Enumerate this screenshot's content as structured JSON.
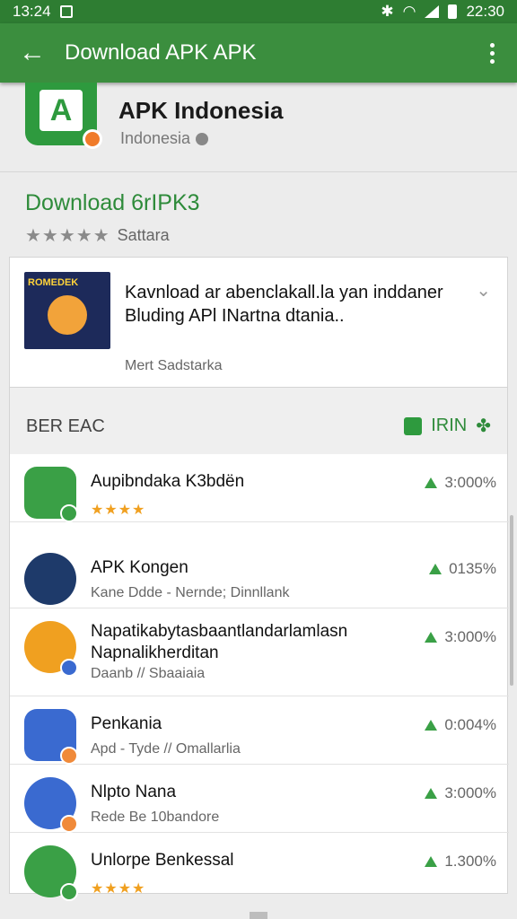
{
  "status_bar": {
    "time": "13:24",
    "clock_right": "22:30",
    "icons": [
      "notification-icon",
      "bluetooth-icon",
      "wifi-icon",
      "signal-icon",
      "battery-icon"
    ]
  },
  "app_bar": {
    "title": "Download APK APK",
    "back_icon": "arrow-back-icon",
    "menu_icon": "more-vert-icon"
  },
  "app": {
    "name": "APK Indonesia",
    "subtitle": "Indonesia",
    "icon_letter": "A"
  },
  "download": {
    "title": "Download 6rIPK3",
    "rating_label": "Sattara",
    "stars": "★★★★★"
  },
  "feature": {
    "thumb_brand": "ROMEDEK",
    "text": "Kavnload ar abenclakall.la yan inddaner Bluding APl INartna dtania..",
    "meta": "Mert Sadstarka"
  },
  "section": {
    "label": "BER EAC",
    "right_label": "IRIN"
  },
  "colors": {
    "app_bar": "#3b8e3e",
    "status_bar": "#2e7d32",
    "accent_green": "#2e8b3a",
    "star_gold": "#f0a020"
  },
  "list": [
    {
      "name": "Aupibndaka K3bdën",
      "desc": "",
      "stars": "★★★★",
      "pct": "3:000%",
      "icon_color": "#3aa046",
      "badge_color": "#3aa046"
    },
    {
      "name": "APK Kongen",
      "desc": "Kane Ddde - Nernde; Dinnllank",
      "stars": "",
      "pct": "0135%",
      "icon_color": "#1e3a6a",
      "badge_color": ""
    },
    {
      "name": "Napatikabytasbaantlandarlamlasn Napnalikherditan",
      "desc": "Daanb // Sbaaiaia",
      "stars": "",
      "pct": "3:000%",
      "icon_color": "#f0a020",
      "badge_color": "#3a6ad0"
    },
    {
      "name": "Penkania",
      "desc": "Aрd - Tyde // Omallarlia",
      "stars": "",
      "pct": "0:004%",
      "icon_color": "#3a6ad0",
      "badge_color": "#f08a3a"
    },
    {
      "name": "Nlpto Nana",
      "desc": "Rede Be 10bandore",
      "stars": "",
      "pct": "3:000%",
      "icon_color": "#3a6ad0",
      "badge_color": "#f08a3a"
    },
    {
      "name": "Unlorpe Benkessal",
      "desc": "",
      "stars": "★★★★",
      "pct": "1.300%",
      "icon_color": "#3aa046",
      "badge_color": "#3aa046"
    }
  ]
}
